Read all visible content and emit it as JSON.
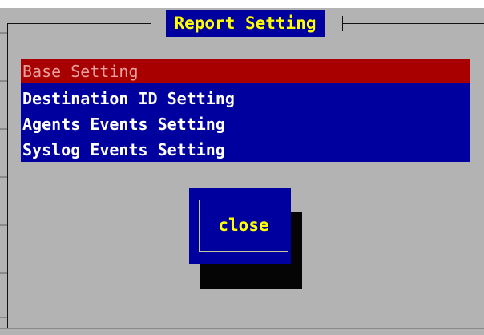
{
  "dialog": {
    "title": "Report Setting"
  },
  "menu": {
    "items": [
      {
        "label": "Base Setting",
        "selected": true
      },
      {
        "label": "Destination ID Setting",
        "selected": false
      },
      {
        "label": "Agents Events Setting",
        "selected": false
      },
      {
        "label": "Syslog Events Setting",
        "selected": false
      }
    ]
  },
  "buttons": {
    "close_label": "close"
  },
  "colors": {
    "background": "#b3b3b3",
    "menu_background": "#00009e",
    "selected_background": "#a80000",
    "title_text": "#ffff00",
    "button_text": "#ffff00",
    "menu_text": "#ffffff"
  }
}
